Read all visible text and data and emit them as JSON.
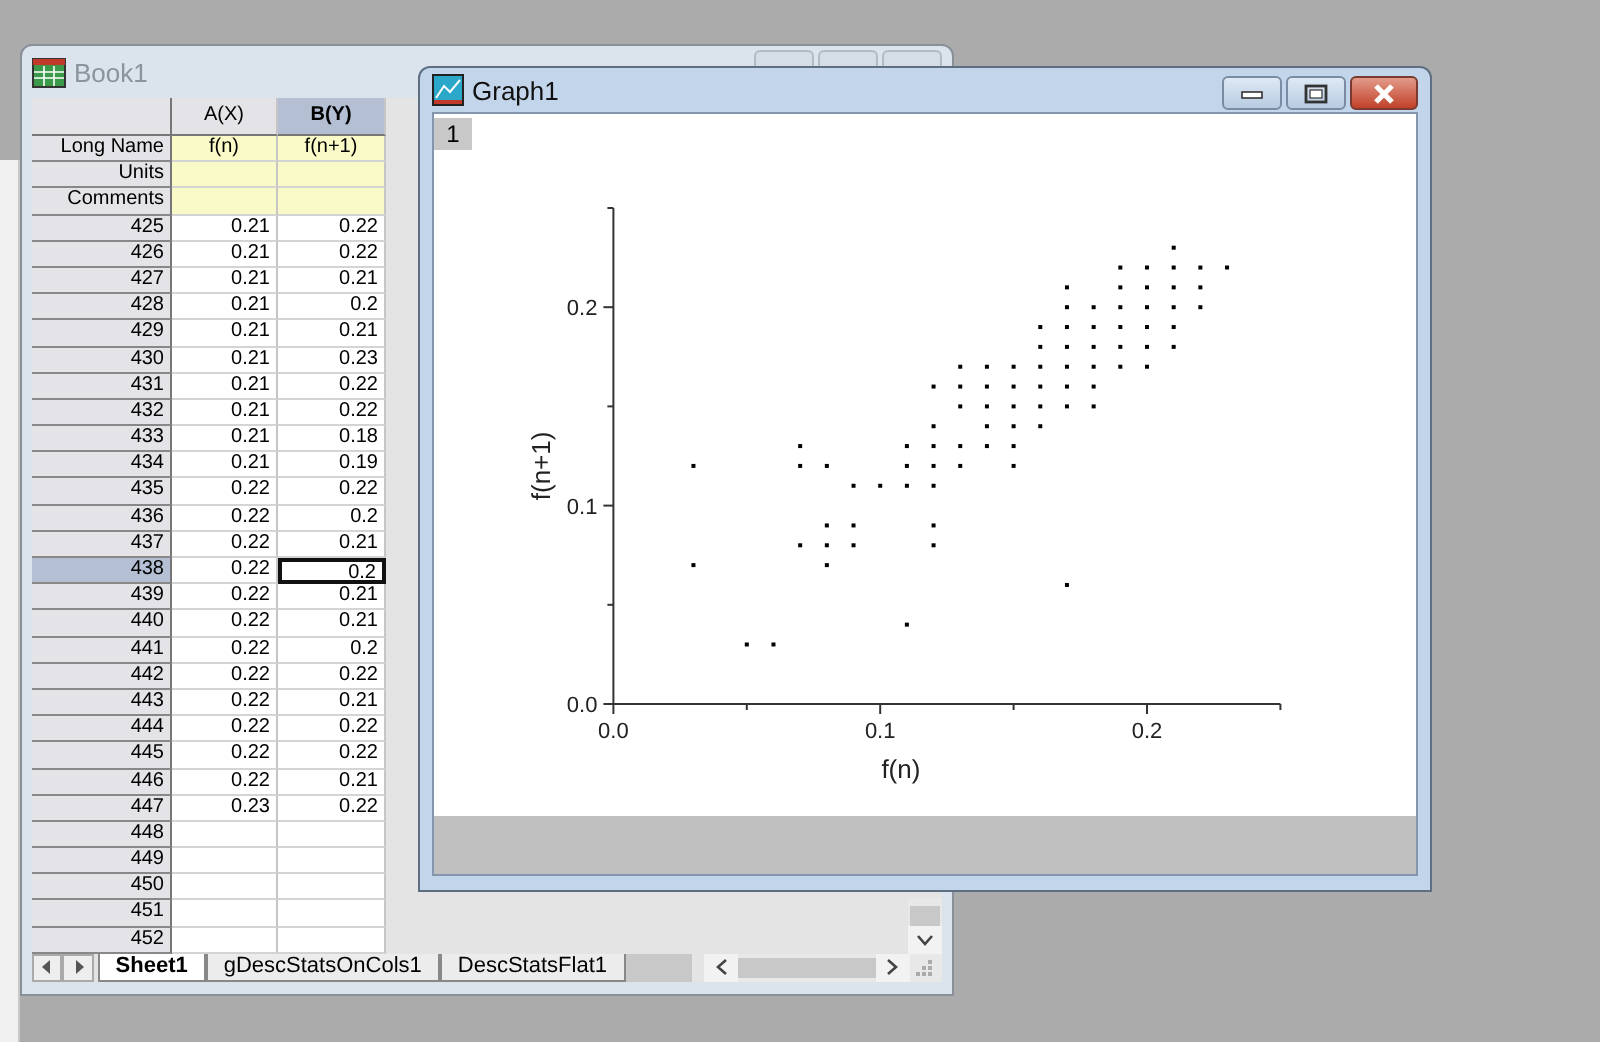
{
  "book": {
    "title": "Book1",
    "columns": [
      {
        "label": "A(X)",
        "selected": false
      },
      {
        "label": "B(Y)",
        "selected": true
      }
    ],
    "header_rows": [
      {
        "label": "Long Name",
        "values": [
          "f(n)",
          "f(n+1)"
        ]
      },
      {
        "label": "Units",
        "values": []
      },
      {
        "label": "Comments",
        "values": []
      }
    ],
    "rows": [
      {
        "index": "425",
        "values": [
          "0.21",
          "0.22"
        ],
        "selected": false
      },
      {
        "index": "426",
        "values": [
          "0.21",
          "0.22"
        ],
        "selected": false
      },
      {
        "index": "427",
        "values": [
          "0.21",
          "0.21"
        ],
        "selected": false
      },
      {
        "index": "428",
        "values": [
          "0.21",
          "0.2"
        ],
        "selected": false
      },
      {
        "index": "429",
        "values": [
          "0.21",
          "0.21"
        ],
        "selected": false
      },
      {
        "index": "430",
        "values": [
          "0.21",
          "0.23"
        ],
        "selected": false
      },
      {
        "index": "431",
        "values": [
          "0.21",
          "0.22"
        ],
        "selected": false
      },
      {
        "index": "432",
        "values": [
          "0.21",
          "0.22"
        ],
        "selected": false
      },
      {
        "index": "433",
        "values": [
          "0.21",
          "0.18"
        ],
        "selected": false
      },
      {
        "index": "434",
        "values": [
          "0.21",
          "0.19"
        ],
        "selected": false
      },
      {
        "index": "435",
        "values": [
          "0.22",
          "0.22"
        ],
        "selected": false
      },
      {
        "index": "436",
        "values": [
          "0.22",
          "0.2"
        ],
        "selected": false
      },
      {
        "index": "437",
        "values": [
          "0.22",
          "0.21"
        ],
        "selected": false
      },
      {
        "index": "438",
        "values": [
          "0.22",
          "0.2"
        ],
        "selected": true
      },
      {
        "index": "439",
        "values": [
          "0.22",
          "0.21"
        ],
        "selected": false
      },
      {
        "index": "440",
        "values": [
          "0.22",
          "0.21"
        ],
        "selected": false
      },
      {
        "index": "441",
        "values": [
          "0.22",
          "0.2"
        ],
        "selected": false
      },
      {
        "index": "442",
        "values": [
          "0.22",
          "0.22"
        ],
        "selected": false
      },
      {
        "index": "443",
        "values": [
          "0.22",
          "0.21"
        ],
        "selected": false
      },
      {
        "index": "444",
        "values": [
          "0.22",
          "0.22"
        ],
        "selected": false
      },
      {
        "index": "445",
        "values": [
          "0.22",
          "0.22"
        ],
        "selected": false
      },
      {
        "index": "446",
        "values": [
          "0.22",
          "0.21"
        ],
        "selected": false
      },
      {
        "index": "447",
        "values": [
          "0.23",
          "0.22"
        ],
        "selected": false
      },
      {
        "index": "448",
        "values": [],
        "selected": false
      },
      {
        "index": "449",
        "values": [],
        "selected": false
      },
      {
        "index": "450",
        "values": [],
        "selected": false
      },
      {
        "index": "451",
        "values": [],
        "selected": false
      },
      {
        "index": "452",
        "values": [],
        "selected": false
      }
    ],
    "sheet_tabs": [
      {
        "label": "Sheet1",
        "selected": true
      },
      {
        "label": "gDescStatsOnCols1",
        "selected": false
      },
      {
        "label": "DescStatsFlat1",
        "selected": false
      }
    ]
  },
  "graph": {
    "title": "Graph1",
    "layer": "1",
    "chart_data": {
      "type": "scatter",
      "xlabel": "f(n)",
      "ylabel": "f(n+1)",
      "xlim": [
        0,
        0.25
      ],
      "ylim": [
        0,
        0.25
      ],
      "xticks": [
        {
          "value": 0,
          "label": "0.0"
        },
        {
          "value": 0.1,
          "label": "0.1"
        },
        {
          "value": 0.2,
          "label": "0.2"
        }
      ],
      "yticks": [
        {
          "value": 0,
          "label": "0.0"
        },
        {
          "value": 0.1,
          "label": "0.1"
        },
        {
          "value": 0.2,
          "label": "0.2"
        }
      ],
      "x": [
        0.03,
        0.03,
        0.05,
        0.06,
        0.07,
        0.07,
        0.07,
        0.08,
        0.08,
        0.08,
        0.08,
        0.09,
        0.09,
        0.09,
        0.1,
        0.11,
        0.11,
        0.11,
        0.11,
        0.12,
        0.12,
        0.12,
        0.12,
        0.12,
        0.12,
        0.12,
        0.13,
        0.13,
        0.13,
        0.13,
        0.13,
        0.14,
        0.14,
        0.14,
        0.14,
        0.14,
        0.15,
        0.15,
        0.15,
        0.15,
        0.15,
        0.15,
        0.16,
        0.16,
        0.16,
        0.16,
        0.16,
        0.16,
        0.17,
        0.17,
        0.17,
        0.17,
        0.17,
        0.17,
        0.17,
        0.17,
        0.18,
        0.18,
        0.18,
        0.18,
        0.18,
        0.18,
        0.19,
        0.19,
        0.19,
        0.19,
        0.19,
        0.19,
        0.2,
        0.2,
        0.2,
        0.2,
        0.2,
        0.2,
        0.21,
        0.21,
        0.21,
        0.21,
        0.21,
        0.21,
        0.22,
        0.22,
        0.22,
        0.23
      ],
      "series": [
        {
          "color": "#000000",
          "values": [
            0.12,
            0.07,
            0.03,
            0.03,
            0.13,
            0.12,
            0.08,
            0.12,
            0.09,
            0.08,
            0.07,
            0.11,
            0.09,
            0.08,
            0.11,
            0.13,
            0.12,
            0.11,
            0.04,
            0.16,
            0.14,
            0.13,
            0.12,
            0.11,
            0.09,
            0.08,
            0.17,
            0.16,
            0.15,
            0.13,
            0.12,
            0.17,
            0.16,
            0.15,
            0.14,
            0.13,
            0.17,
            0.16,
            0.15,
            0.14,
            0.13,
            0.12,
            0.19,
            0.18,
            0.17,
            0.16,
            0.15,
            0.14,
            0.21,
            0.2,
            0.19,
            0.18,
            0.17,
            0.16,
            0.15,
            0.06,
            0.2,
            0.19,
            0.18,
            0.17,
            0.16,
            0.15,
            0.22,
            0.21,
            0.2,
            0.19,
            0.18,
            0.17,
            0.22,
            0.21,
            0.2,
            0.19,
            0.18,
            0.17,
            0.23,
            0.22,
            0.21,
            0.2,
            0.19,
            0.18,
            0.22,
            0.21,
            0.2,
            0.22
          ]
        }
      ]
    }
  }
}
